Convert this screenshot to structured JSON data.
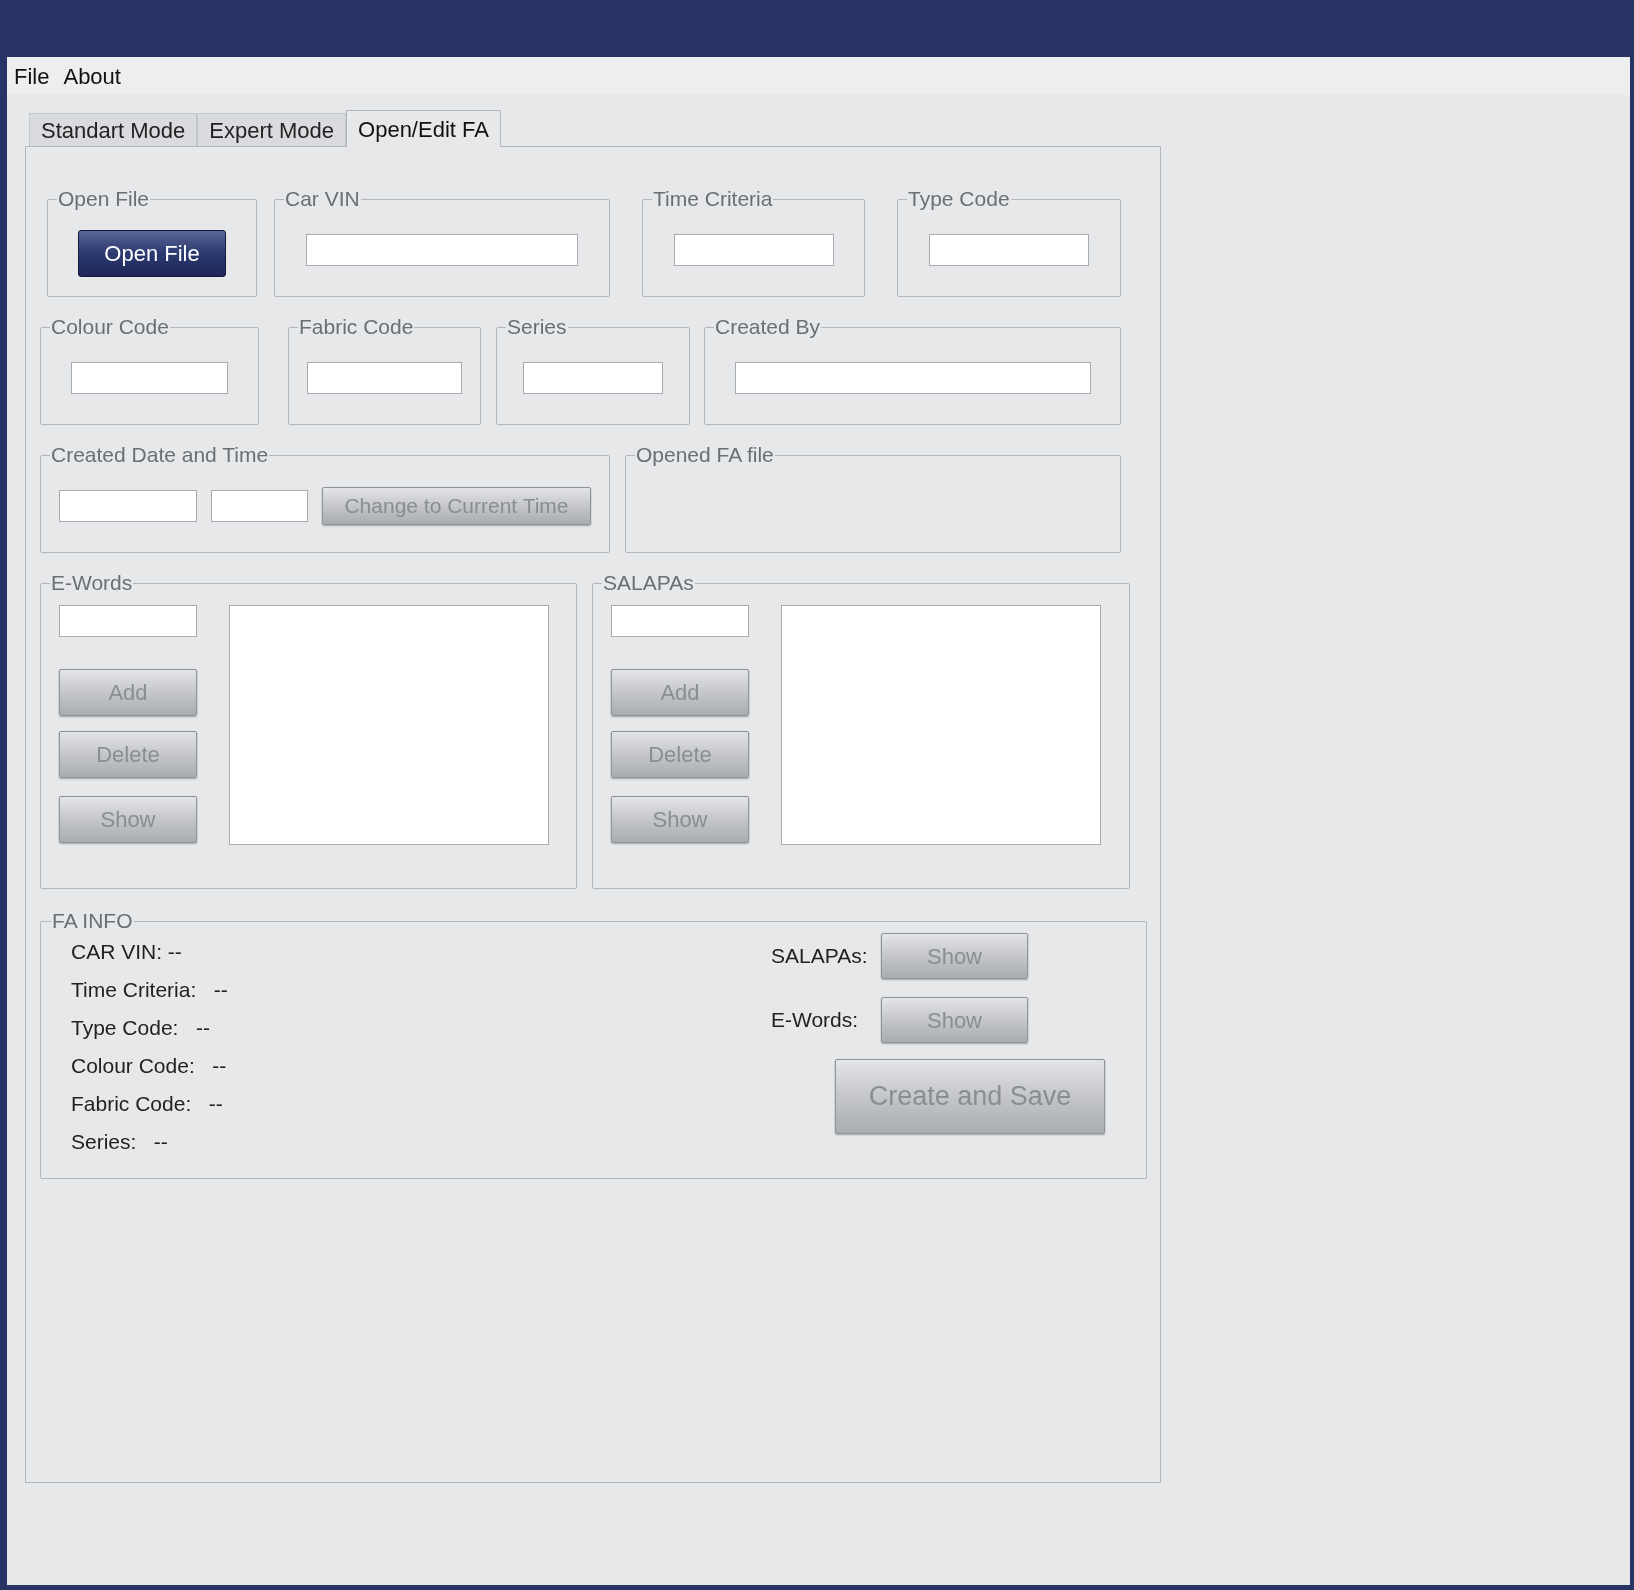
{
  "menu": [
    {
      "label": "File"
    },
    {
      "label": "About"
    }
  ],
  "tabs": [
    {
      "label": "Standart Mode",
      "selected": false
    },
    {
      "label": "Expert Mode",
      "selected": false
    },
    {
      "label": "Open/Edit FA",
      "selected": true
    }
  ],
  "rows": [
    [
      {
        "kind": "button",
        "title": "Open File",
        "button": "Open File"
      },
      {
        "kind": "field",
        "title": "Car VIN"
      },
      {
        "kind": "field",
        "title": "Time Criteria"
      },
      {
        "kind": "field",
        "title": "Type Code"
      }
    ],
    [
      {
        "kind": "field",
        "title": "Colour Code"
      },
      {
        "kind": "field",
        "title": "Fabric Code"
      },
      {
        "kind": "field",
        "title": "Series"
      },
      {
        "kind": "field",
        "title": "Created By"
      }
    ],
    [
      {
        "kind": "datetime",
        "title": "Created Date and Time",
        "button": "Change to Current Time"
      },
      {
        "kind": "blank",
        "title": "Opened FA file"
      }
    ],
    [
      {
        "kind": "list",
        "title": "E-Words",
        "buttons": [
          "Add",
          "Delete",
          "Show"
        ]
      },
      {
        "kind": "list",
        "title": "SALAPAs",
        "buttons": [
          "Add",
          "Delete",
          "Show"
        ]
      }
    ]
  ],
  "fa_info": {
    "title": "FA INFO",
    "lines": [
      "CAR VIN: --",
      "Time Criteria:   --",
      "Type Code:   --",
      "Colour Code:   --",
      "Fabric Code:   --",
      "Series:   --"
    ],
    "show_rows": [
      {
        "label": "SALAPAs:",
        "button": "Show"
      },
      {
        "label": "E-Words:",
        "button": "Show"
      }
    ],
    "save_button": "Create and Save"
  }
}
